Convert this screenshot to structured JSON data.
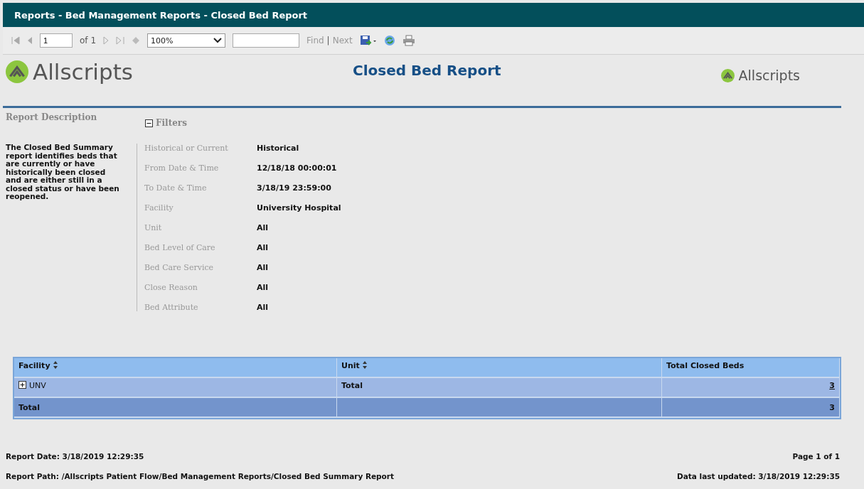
{
  "window": {
    "title": "Reports - Bed Management Reports - Closed Bed Report"
  },
  "toolbar": {
    "page": "1",
    "page_count": "of 1",
    "zoom": "100%",
    "find": "Find",
    "separator": "|",
    "next": "Next"
  },
  "header": {
    "logo_text": "Allscripts",
    "title": "Closed Bed Report",
    "logo_text_right": "Allscripts"
  },
  "section_labels": {
    "description": "Report Description",
    "filters": "Filters",
    "filters_expanded": true
  },
  "description": "The Closed Bed Summary report identifies beds that are currently or have historically been closed and are either still in a closed status or have been reopened.",
  "filters": [
    {
      "label": "Historical or Current",
      "value": "Historical"
    },
    {
      "label": "From Date & Time",
      "value": "12/18/18 00:00:01"
    },
    {
      "label": "To Date & Time",
      "value": "3/18/19 23:59:00"
    },
    {
      "label": "Facility",
      "value": "University Hospital"
    },
    {
      "label": "Unit",
      "value": "All"
    },
    {
      "label": "Bed Level of Care",
      "value": "All"
    },
    {
      "label": "Bed Care Service",
      "value": "All"
    },
    {
      "label": "Close Reason",
      "value": "All"
    },
    {
      "label": "Bed Attribute",
      "value": "All"
    }
  ],
  "table": {
    "columns": [
      {
        "label": "Facility",
        "sortable": true
      },
      {
        "label": "Unit",
        "sortable": true
      },
      {
        "label": "Total Closed Beds",
        "sortable": false
      }
    ],
    "rows": [
      {
        "kind": "group",
        "expanded": false,
        "cells": [
          "UNV",
          "Total",
          "3"
        ]
      },
      {
        "kind": "total",
        "cells": [
          "Total",
          "",
          "3"
        ]
      }
    ]
  },
  "footer": {
    "report_date": "Report Date: 3/18/2019 12:29:35",
    "page": "Page 1 of 1",
    "report_path": "Report Path: /Allscripts Patient Flow/Bed Management Reports/Closed Bed Summary Report",
    "updated": "Data last updated: 3/18/2019 12:29:35"
  }
}
